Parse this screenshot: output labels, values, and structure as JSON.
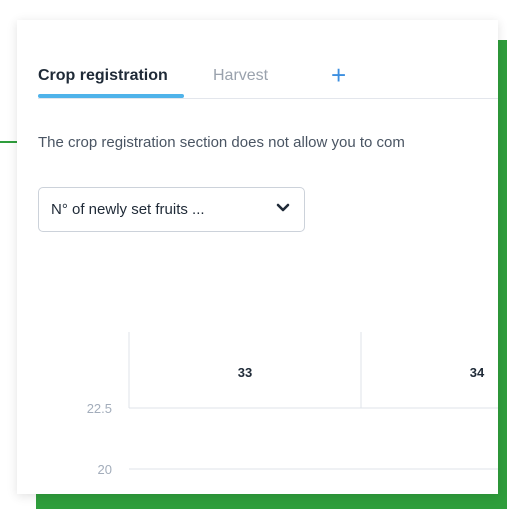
{
  "tabs": {
    "active_label": "Crop registration",
    "inactive_label": "Harvest",
    "add_label": "+"
  },
  "info": {
    "text": "The crop registration section does not allow you to com"
  },
  "dropdown": {
    "value": "N° of newly set fruits ..."
  },
  "colors": {
    "accent_green": "#2f9e3c",
    "tab_underline": "#4fb3ea",
    "add_blue": "#3d8fe0"
  },
  "icons": [
    "plus-icon",
    "chevron-down-icon"
  ],
  "chart_data": {
    "type": "line",
    "x": [
      "33",
      "34"
    ],
    "y_ticks": [
      "22.5",
      "20"
    ],
    "series": []
  }
}
